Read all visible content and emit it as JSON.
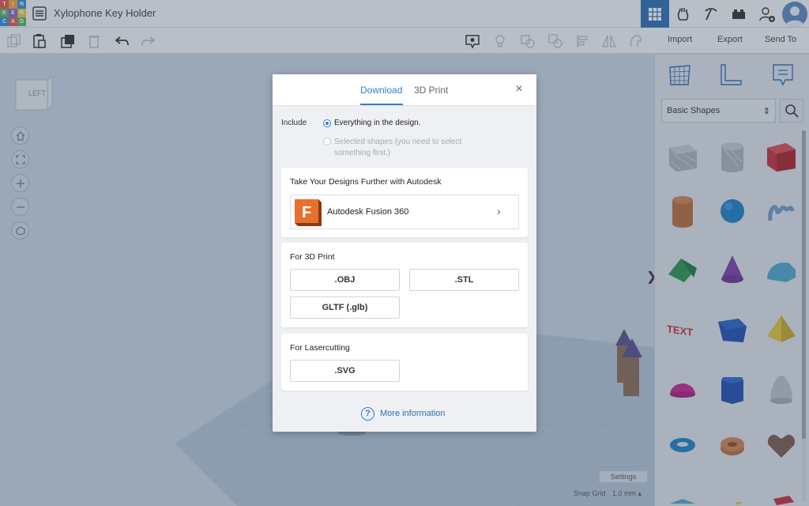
{
  "app": {
    "logo_letters": [
      "T",
      "I",
      "N",
      "K",
      "E",
      "R",
      "C",
      "A",
      "D"
    ],
    "logo_colors": [
      "#e2574c",
      "#f0a13a",
      "#2f8fd6",
      "#58b368",
      "#8d5fc9",
      "#f0c640",
      "#2f8fd6",
      "#e2574c",
      "#58b368"
    ],
    "design_title": "Xylophone Key Holder"
  },
  "toolbar": {
    "import_label": "Import",
    "export_label": "Export",
    "send_to_label": "Send To"
  },
  "workspace": {
    "viewcube_label": "LEFT",
    "settings_label": "Settings",
    "snap_grid_label": "Snap Grid",
    "snap_grid_value": "1.0 mm ▴"
  },
  "shapes_panel": {
    "category_selected": "Basic Shapes",
    "category_arrows": "⇕",
    "collapse_glyph": "❯",
    "shapes": [
      "box-hole",
      "cylinder-hole",
      "box",
      "cylinder",
      "sphere",
      "scribble",
      "roof",
      "cone",
      "round-roof",
      "text",
      "wedge",
      "pyramid",
      "half-sphere",
      "polygon",
      "paraboloid",
      "torus",
      "tube",
      "heart",
      "star",
      "ring",
      "gem"
    ]
  },
  "modal": {
    "tabs": [
      "Download",
      "3D Print"
    ],
    "active_tab": "Download",
    "close_glyph": "×",
    "include_label": "Include",
    "option_everything": "Everything in the design.",
    "option_selected": "Selected shapes (you need to select something first.)",
    "autodesk_section": {
      "title": "Take Your Designs Further with Autodesk",
      "fusion_logo_letter": "F",
      "fusion_label": "Autodesk Fusion 360",
      "chevron": "›"
    },
    "print_section": {
      "title": "For 3D Print",
      "formats": [
        ".OBJ",
        ".STL",
        "GLTF (.glb)"
      ]
    },
    "laser_section": {
      "title": "For Lasercutting",
      "formats": [
        ".SVG"
      ]
    },
    "more_info_icon": "?",
    "more_info_label": "More information"
  },
  "colors": {
    "accent": "#2f7fd1",
    "fusion_orange": "#e8702a"
  }
}
